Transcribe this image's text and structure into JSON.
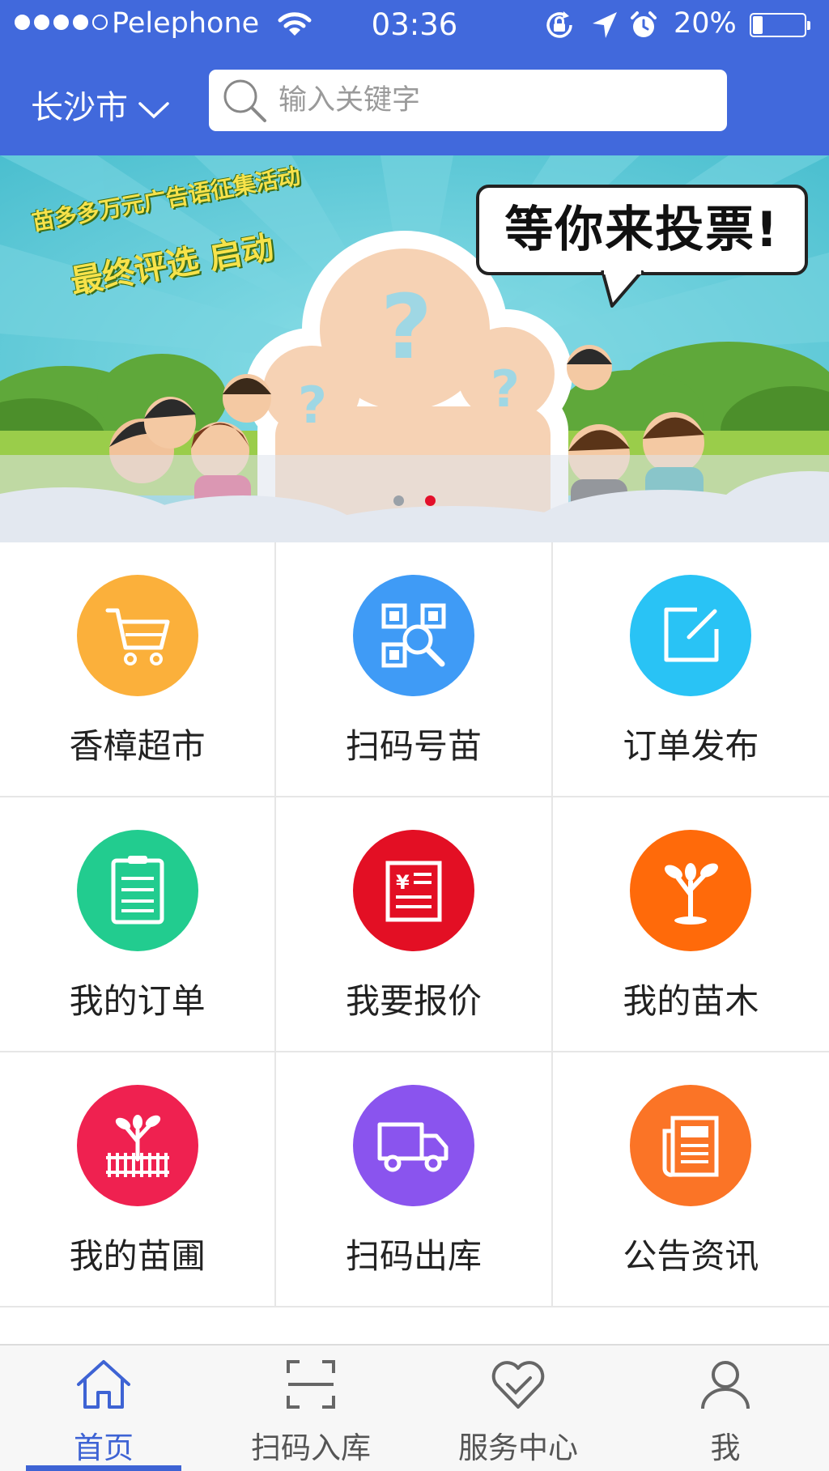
{
  "status_bar": {
    "carrier": "Pelephone",
    "time": "03:36",
    "battery_percent": "20%",
    "battery_level": 0.2,
    "signal_bars": 4,
    "icons": [
      "wifi-icon",
      "rotation-lock-icon",
      "location-arrow-icon",
      "alarm-icon",
      "battery-icon"
    ]
  },
  "header": {
    "city": "长沙市",
    "search_placeholder": "输入关键字",
    "background_color": "#4169dc"
  },
  "banner": {
    "slogan_line1": "苗多多万元广告语征集活动",
    "slogan_line2": "最终评选 启动",
    "bubble_text": "等你来投票!",
    "slide_count": 2,
    "active_slide": 2
  },
  "grid": {
    "items": [
      {
        "label": "香樟超市",
        "icon": "shopping-cart-icon",
        "color": "#fbb03b"
      },
      {
        "label": "扫码号苗",
        "icon": "qr-scan-icon",
        "color": "#3f9bf6"
      },
      {
        "label": "订单发布",
        "icon": "edit-icon",
        "color": "#29c3f5"
      },
      {
        "label": "我的订单",
        "icon": "order-list-icon",
        "color": "#22cc8f"
      },
      {
        "label": "我要报价",
        "icon": "quote-icon",
        "color": "#e30f24"
      },
      {
        "label": "我的苗木",
        "icon": "seedling-icon",
        "color": "#ff6a0a"
      },
      {
        "label": "我的苗圃",
        "icon": "nursery-icon",
        "color": "#ef2150"
      },
      {
        "label": "扫码出库",
        "icon": "delivery-truck-icon",
        "color": "#8a54ee"
      },
      {
        "label": "公告资讯",
        "icon": "newspaper-icon",
        "color": "#fb7426"
      }
    ]
  },
  "tabbar": {
    "active_color": "#3e63d4",
    "tabs": [
      {
        "label": "首页",
        "icon": "home-icon",
        "active": true
      },
      {
        "label": "扫码入库",
        "icon": "scan-icon",
        "active": false
      },
      {
        "label": "服务中心",
        "icon": "heart-check-icon",
        "active": false
      },
      {
        "label": "我",
        "icon": "user-icon",
        "active": false
      }
    ]
  }
}
